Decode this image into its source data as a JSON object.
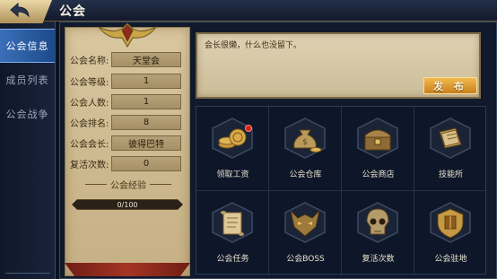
{
  "header": {
    "title": "公会"
  },
  "sidebar": {
    "items": [
      {
        "label": "公会信息",
        "active": true
      },
      {
        "label": "成员列表",
        "active": false
      },
      {
        "label": "公会战争",
        "active": false
      }
    ]
  },
  "guild_info": {
    "rows": [
      {
        "label": "公会名称:",
        "value": "天堂会"
      },
      {
        "label": "公会等级:",
        "value": "1"
      },
      {
        "label": "公会人数:",
        "value": "1"
      },
      {
        "label": "公会排名:",
        "value": "8"
      },
      {
        "label": "公会会长:",
        "value": "彼得巴特"
      },
      {
        "label": "复活次数:",
        "value": "0"
      }
    ],
    "exp_title": "公会经验",
    "exp_text": "0/100",
    "exp_progress": 0
  },
  "announcement": {
    "text": "会长很懒，什么也没留下。",
    "publish_label": "发 布"
  },
  "functions": [
    {
      "label": "领取工资",
      "icon": "coins-icon",
      "badge": true
    },
    {
      "label": "公会仓库",
      "icon": "money-bag-icon",
      "badge": false
    },
    {
      "label": "公会商店",
      "icon": "treasure-chest-icon",
      "badge": false
    },
    {
      "label": "技能所",
      "icon": "skill-book-icon",
      "badge": false
    },
    {
      "label": "公会任务",
      "icon": "scroll-icon",
      "badge": false
    },
    {
      "label": "公会BOSS",
      "icon": "demon-mask-icon",
      "badge": false
    },
    {
      "label": "复活次数",
      "icon": "skull-icon",
      "badge": false
    },
    {
      "label": "公会驻地",
      "icon": "castle-icon",
      "badge": false
    }
  ],
  "colors": {
    "accent_gold": "#c7801d",
    "active_tab": "#3a6fb8",
    "parchment": "#d9c7a1",
    "badge_red": "#d8201a"
  }
}
